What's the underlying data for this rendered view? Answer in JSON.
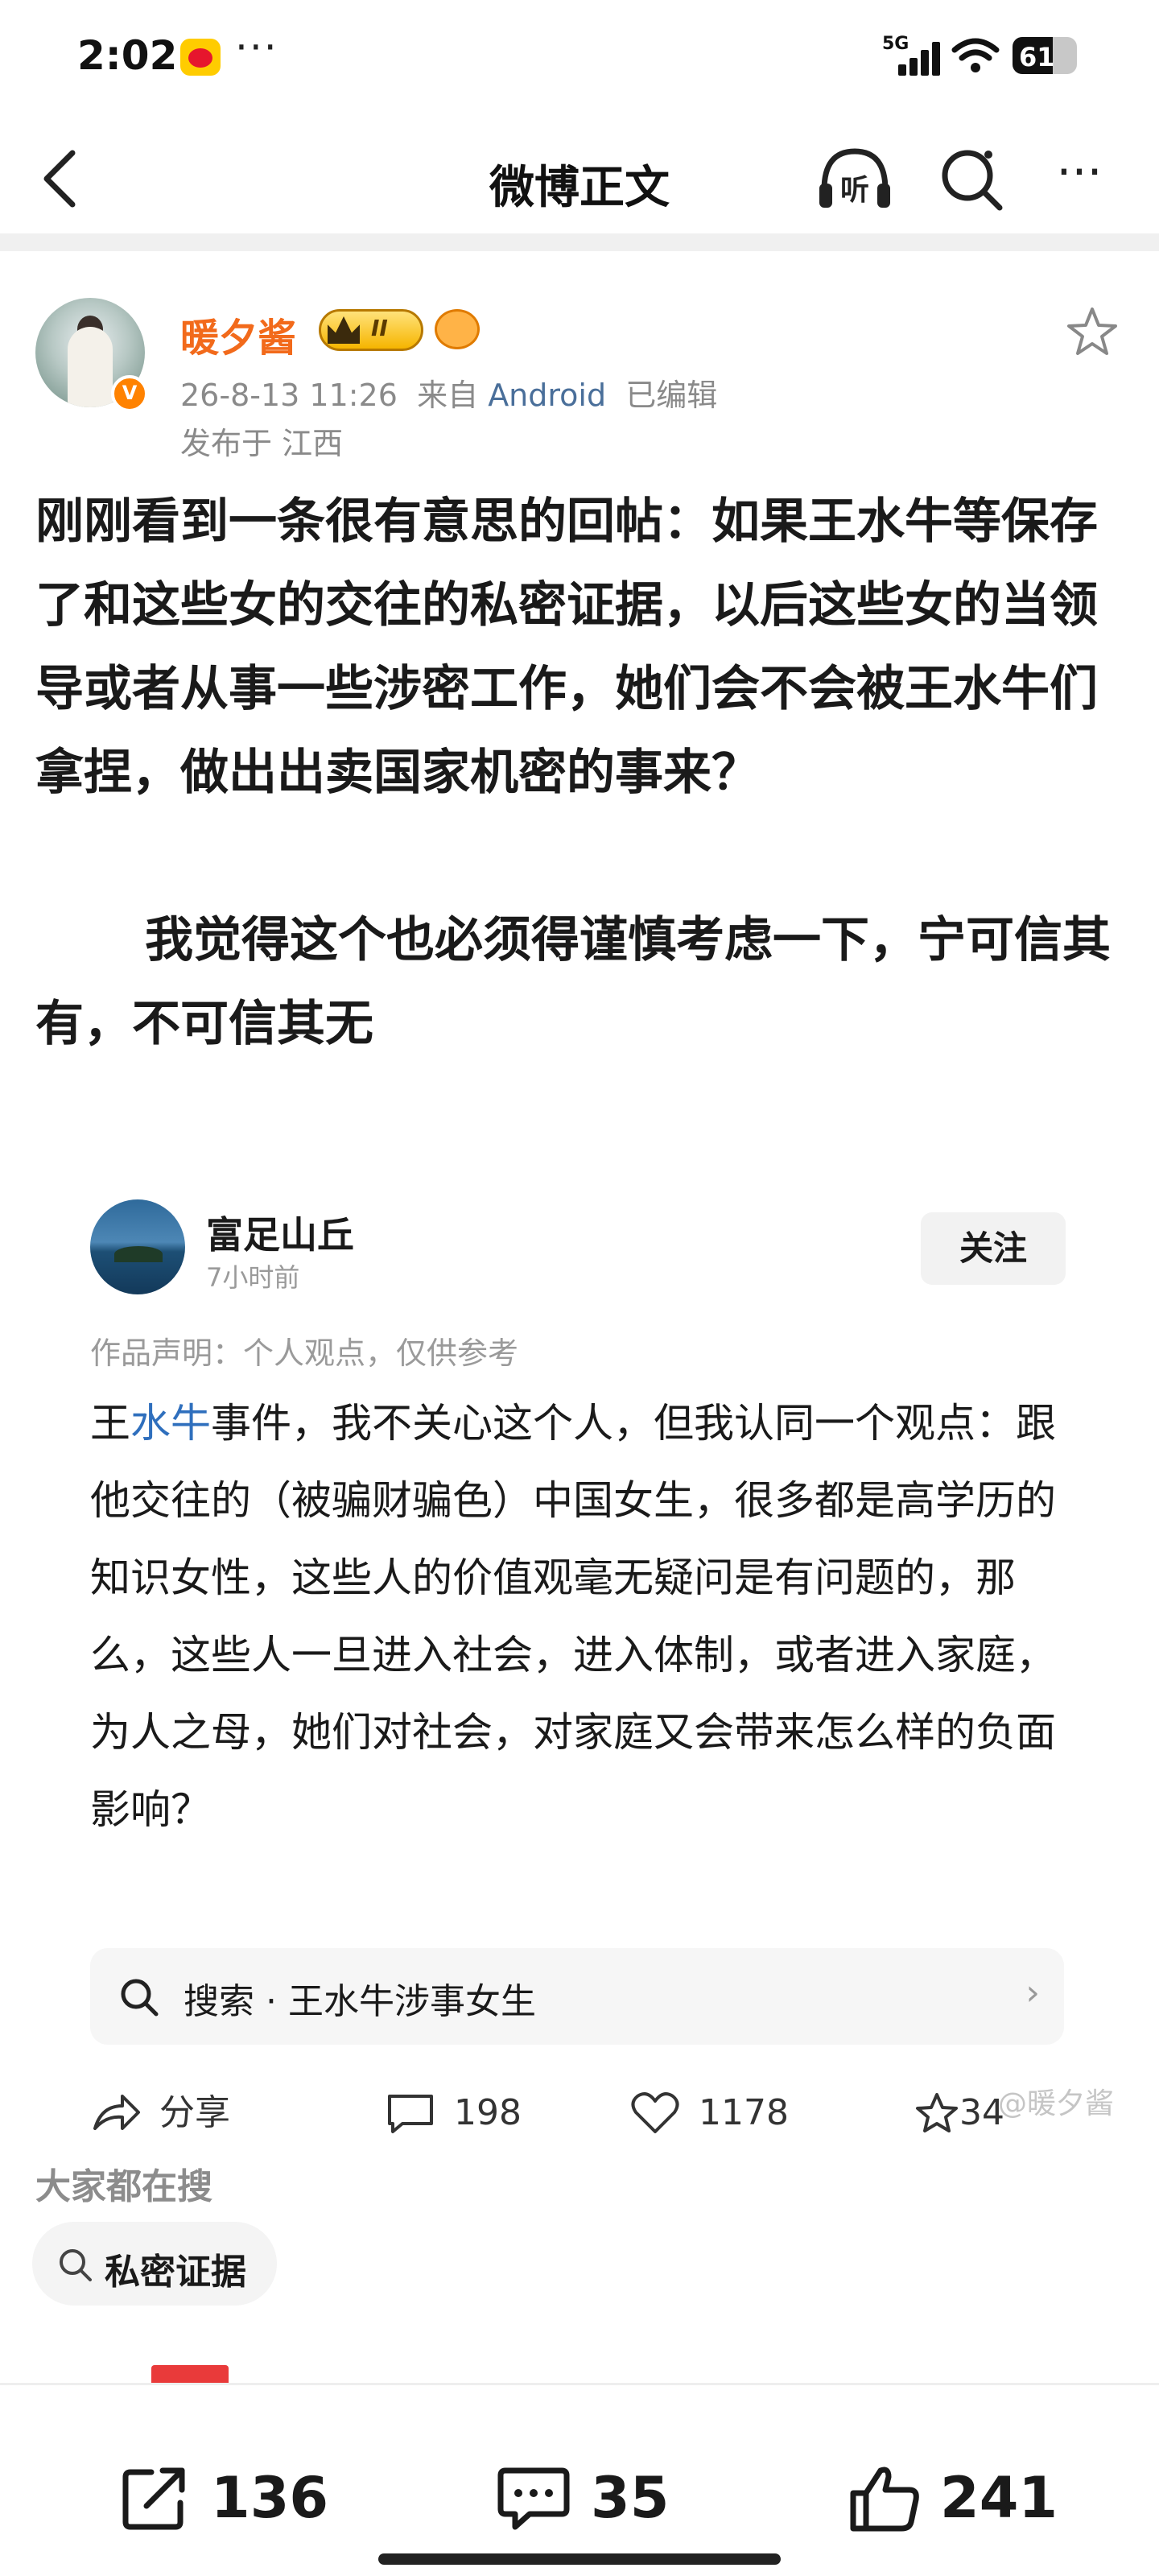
{
  "status_bar": {
    "time": "2:02",
    "dots": "···",
    "network": "5G",
    "battery": "61"
  },
  "nav": {
    "title": "微博正文",
    "listen_label": "听"
  },
  "post": {
    "author": "暖夕酱",
    "vip_level": "II",
    "verified_mark": "V",
    "date": "26-8-13 11:26",
    "source_prefix": "来自",
    "source": "Android",
    "edited": "已编辑",
    "location": "发布于 江西",
    "text_p1": "刚刚看到一条很有意思的回帖：如果王水牛等保存了和这些女的交往的私密证据，以后这些女的当领导或者从事一些涉密工作，她们会不会被王水牛们拿捏，做出出卖国家机密的事来？",
    "text_p2": "我觉得这个也必须得谨慎考虑一下，宁可信其有，不可信其无"
  },
  "quote": {
    "name": "富足山丘",
    "time": "7小时前",
    "follow": "关注",
    "declaration": "作品声明：个人观点，仅供参考",
    "body_pre": "王",
    "body_highlight": "水牛",
    "body_post": "事件，我不关心这个人，但我认同一个观点：跟他交往的（被骗财骗色）中国女生，很多都是高学历的知识女性，这些人的价值观毫无疑问是有问题的，那么，这些人一旦进入社会，进入体制，或者进入家庭，为人之母，她们对社会，对家庭又会带来怎么样的负面影响？",
    "search": "搜索 · 王水牛涉事女生",
    "share": "分享",
    "comments": "198",
    "likes": "1178",
    "stars": "34",
    "watermark": "@暖夕酱"
  },
  "hot_search": {
    "title": "大家都在搜",
    "chip": "私密证据"
  },
  "bottom_bar": {
    "reposts": "136",
    "comments": "35",
    "likes": "241"
  },
  "colors": {
    "username": "#f26a1b",
    "link": "#2f6fbd",
    "source": "#4a6f9a",
    "verified": "#ff8200"
  }
}
